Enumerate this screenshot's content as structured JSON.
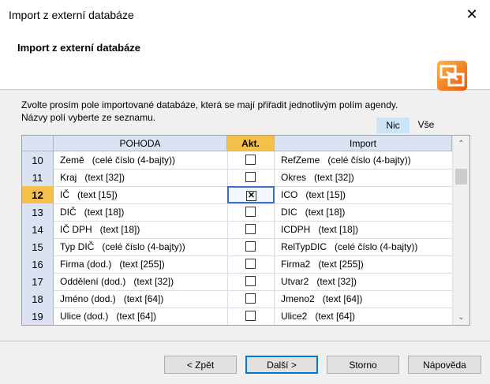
{
  "window": {
    "title": "Import z externí databáze",
    "close_glyph": "✕"
  },
  "header": {
    "title": "Import z externí databáze",
    "icon": "import-database-icon"
  },
  "instructions": {
    "line1": "Zvolte prosím pole importované databáze, která se mají přiřadit jednotlivým polím agendy.",
    "line2": "Názvy polí vyberte ze seznamu."
  },
  "toggles": {
    "nic": "Nic",
    "vse": "Vše"
  },
  "grid": {
    "headers": {
      "pohoda": "POHODA",
      "akt": "Akt.",
      "import": "Import"
    },
    "rows": [
      {
        "num": "10",
        "pohoda_name": "Země",
        "pohoda_type": "(celé číslo (4-bajty))",
        "checked": false,
        "active": false,
        "import_name": "RefZeme",
        "import_type": "(celé číslo (4-bajty))"
      },
      {
        "num": "11",
        "pohoda_name": "Kraj",
        "pohoda_type": "(text [32])",
        "checked": false,
        "active": false,
        "import_name": "Okres",
        "import_type": "(text [32])"
      },
      {
        "num": "12",
        "pohoda_name": "IČ",
        "pohoda_type": "(text [15])",
        "checked": true,
        "active": true,
        "import_name": "ICO",
        "import_type": "(text [15])"
      },
      {
        "num": "13",
        "pohoda_name": "DIČ",
        "pohoda_type": "(text [18])",
        "checked": false,
        "active": false,
        "import_name": "DIC",
        "import_type": "(text [18])"
      },
      {
        "num": "14",
        "pohoda_name": "IČ DPH",
        "pohoda_type": "(text [18])",
        "checked": false,
        "active": false,
        "import_name": "ICDPH",
        "import_type": "(text [18])"
      },
      {
        "num": "15",
        "pohoda_name": "Typ DIČ",
        "pohoda_type": "(celé číslo (4-bajty))",
        "checked": false,
        "active": false,
        "import_name": "RelTypDIC",
        "import_type": "(celé číslo (4-bajty))"
      },
      {
        "num": "16",
        "pohoda_name": "Firma (dod.)",
        "pohoda_type": "(text [255])",
        "checked": false,
        "active": false,
        "import_name": "Firma2",
        "import_type": "(text [255])"
      },
      {
        "num": "17",
        "pohoda_name": "Oddělení (dod.)",
        "pohoda_type": "(text [32])",
        "checked": false,
        "active": false,
        "import_name": "Utvar2",
        "import_type": "(text [32])"
      },
      {
        "num": "18",
        "pohoda_name": "Jméno (dod.)",
        "pohoda_type": "(text [64])",
        "checked": false,
        "active": false,
        "import_name": "Jmeno2",
        "import_type": "(text [64])"
      },
      {
        "num": "19",
        "pohoda_name": "Ulice (dod.)",
        "pohoda_type": "(text [64])",
        "checked": false,
        "active": false,
        "import_name": "Ulice2",
        "import_type": "(text [64])"
      }
    ],
    "scroll_up_glyph": "⌃",
    "scroll_down_glyph": "⌄"
  },
  "buttons": {
    "back": "< Zpět",
    "next": "Další >",
    "cancel": "Storno",
    "help": "Nápověda"
  }
}
